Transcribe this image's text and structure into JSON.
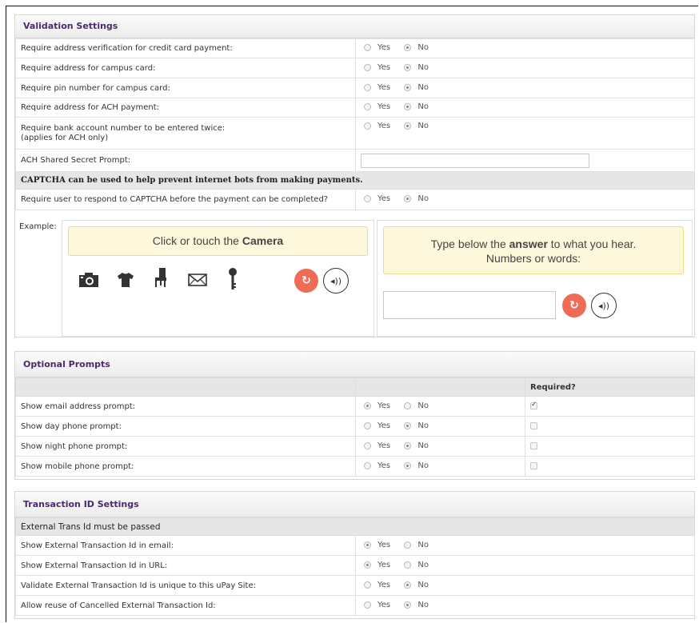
{
  "validation": {
    "title": "Validation Settings",
    "rows": [
      {
        "label": "Require address verification for credit card payment:",
        "yes": "Yes",
        "no": "No",
        "selected": "no"
      },
      {
        "label": "Require address for campus card:",
        "yes": "Yes",
        "no": "No",
        "selected": "no"
      },
      {
        "label": "Require pin number for campus card:",
        "yes": "Yes",
        "no": "No",
        "selected": "no"
      },
      {
        "label": "Require address for ACH payment:",
        "yes": "Yes",
        "no": "No",
        "selected": "no"
      }
    ],
    "bank_row": {
      "label": "Require bank account number to be entered twice:",
      "note": "(applies for ACH only)",
      "yes": "Yes",
      "no": "No",
      "selected": "no"
    },
    "ach_prompt_label": "ACH Shared Secret Prompt:",
    "ach_prompt_value": "",
    "captcha_info": "CAPTCHA can be used to help prevent internet bots from making payments.",
    "captcha_row": {
      "label": "Require user to respond to CAPTCHA before the payment can be completed?",
      "yes": "Yes",
      "no": "No",
      "selected": "no"
    },
    "example_label": "Example:",
    "captcha_left": {
      "prefix": "Click or touch the",
      "strong": "Camera",
      "icons": [
        "camera-icon",
        "shirt-icon",
        "chair-icon",
        "envelope-icon",
        "key-icon"
      ]
    },
    "captcha_right": {
      "line1_prefix": "Type below the",
      "line1_strong": "answer",
      "line1_suffix": "to what you hear.",
      "line2": "Numbers or words:",
      "answer_value": ""
    }
  },
  "optional": {
    "title": "Optional Prompts",
    "required_header": "Required?",
    "rows": [
      {
        "label": "Show email address prompt:",
        "yes": "Yes",
        "no": "No",
        "selected": "yes",
        "required": true
      },
      {
        "label": "Show day phone prompt:",
        "yes": "Yes",
        "no": "No",
        "selected": "no",
        "required": false
      },
      {
        "label": "Show night phone prompt:",
        "yes": "Yes",
        "no": "No",
        "selected": "no",
        "required": false
      },
      {
        "label": "Show mobile phone prompt:",
        "yes": "Yes",
        "no": "No",
        "selected": "no",
        "required": false
      }
    ]
  },
  "transaction": {
    "title": "Transaction ID Settings",
    "subheader": "External Trans Id must be passed",
    "rows": [
      {
        "label": "Show External Transaction Id in email:",
        "yes": "Yes",
        "no": "No",
        "selected": "yes"
      },
      {
        "label": "Show External Transaction Id in URL:",
        "yes": "Yes",
        "no": "No",
        "selected": "yes"
      },
      {
        "label": "Validate External Transaction Id is unique to this uPay Site:",
        "yes": "Yes",
        "no": "No",
        "selected": "no"
      },
      {
        "label": "Allow reuse of Cancelled External Transaction Id:",
        "yes": "Yes",
        "no": "No",
        "selected": "no"
      }
    ]
  }
}
